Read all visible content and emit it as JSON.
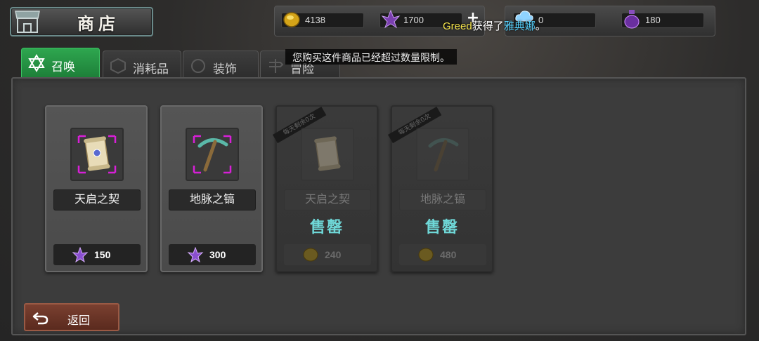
{
  "header": {
    "title": "商店"
  },
  "currency": {
    "gold": "4138",
    "crystal": "1700",
    "cloud": "0",
    "potion": "180"
  },
  "notices": {
    "player": "Greed",
    "obtained": "获得了",
    "item": "雅典娜",
    "end": "。",
    "limit": "您购买这件商品已经超过数量限制。"
  },
  "tabs": [
    {
      "label": "召唤"
    },
    {
      "label": "消耗品"
    },
    {
      "label": "装饰"
    },
    {
      "label": "冒险"
    }
  ],
  "items": [
    {
      "name": "天启之契",
      "price": "150",
      "currency": "crystal",
      "sold": false
    },
    {
      "name": "地脉之镐",
      "price": "300",
      "currency": "crystal",
      "sold": false
    },
    {
      "name": "天启之契",
      "price": "240",
      "currency": "gold",
      "sold": true,
      "sold_label": "售罄",
      "ribbon": "每天剩余0次"
    },
    {
      "name": "地脉之镐",
      "price": "480",
      "currency": "gold",
      "sold": true,
      "sold_label": "售罄",
      "ribbon": "每天剩余0次"
    }
  ],
  "footer": {
    "back_label": "返回"
  },
  "colors": {
    "active_tab": "#2ea64f",
    "sold_text": "#6fd8d8",
    "rare_frame": "#d81fd8"
  }
}
